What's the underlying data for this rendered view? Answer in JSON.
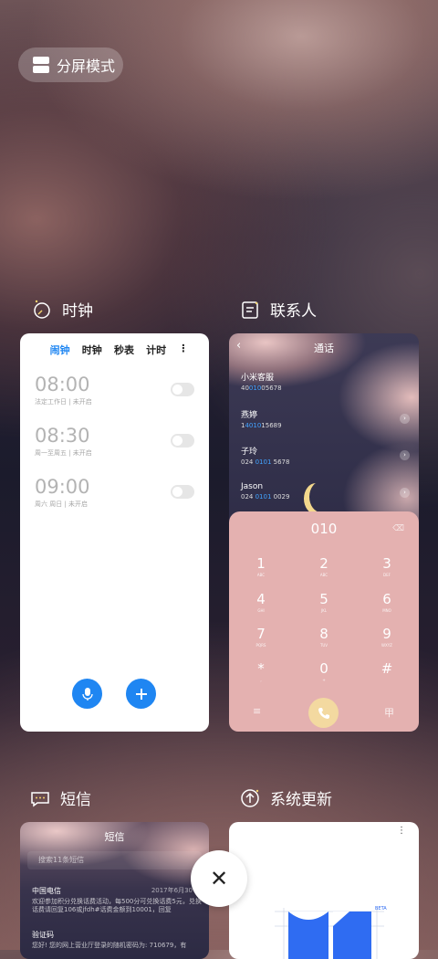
{
  "split_screen": {
    "label": "分屏模式"
  },
  "apps": {
    "clock": {
      "name": "时钟",
      "tabs": [
        {
          "label": "闹钟",
          "active": true
        },
        {
          "label": "时钟",
          "active": false
        },
        {
          "label": "秒表",
          "active": false
        },
        {
          "label": "计时",
          "active": false
        }
      ],
      "more_glyph": "⋮",
      "alarms": [
        {
          "time": "08:00",
          "desc": "法定工作日 | 未开启"
        },
        {
          "time": "08:30",
          "desc": "周一至周五 | 未开启"
        },
        {
          "time": "09:00",
          "desc": "周六 周日 | 未开启"
        }
      ],
      "accent": "#1f86f2"
    },
    "contacts": {
      "name": "联系人",
      "title": "通话",
      "back_glyph": "‹",
      "list": [
        {
          "name": "小米客服",
          "pre": "40",
          "hl": "010",
          "post": "05678"
        },
        {
          "name": "燕婷",
          "pre": "1",
          "hl": "4010",
          "post": "15689"
        },
        {
          "name": "子玲",
          "pre": "024 ",
          "hl": "0101",
          "post": " 5678"
        },
        {
          "name": "Jason",
          "pre": "024 ",
          "hl": "0101",
          "post": " 0029"
        }
      ],
      "dial_number": "010",
      "keys": [
        {
          "d": "1",
          "l": "ABC"
        },
        {
          "d": "2",
          "l": "ABC"
        },
        {
          "d": "3",
          "l": "DEF"
        },
        {
          "d": "4",
          "l": "GHI"
        },
        {
          "d": "5",
          "l": "JKL"
        },
        {
          "d": "6",
          "l": "MNO"
        },
        {
          "d": "7",
          "l": "PQRS"
        },
        {
          "d": "8",
          "l": "TUV"
        },
        {
          "d": "9",
          "l": "WXYZ"
        },
        {
          "d": "*",
          "l": ","
        },
        {
          "d": "0",
          "l": "+"
        },
        {
          "d": "#",
          "l": ""
        }
      ],
      "menu_glyph": "≡",
      "keypad_glyph": "甲"
    },
    "sms": {
      "name": "短信",
      "title": "短信",
      "search_placeholder": "搜索11条短信",
      "messages": [
        {
          "sender": "中国电信",
          "time": "2017年6月30",
          "body": "欢迎参加积分兑换话费活动，每500分可兑换话费5元，兑换话费请回复106或jfdh#话费金额到10001，回复"
        },
        {
          "sender": "验证码",
          "time": "",
          "body": "您好! 您的网上营业厅登录的随机密码为: 710679，有"
        }
      ]
    },
    "update": {
      "name": "系统更新",
      "beta_label": "BETA",
      "more_glyph": "⋮"
    }
  },
  "close_glyph": "✕"
}
